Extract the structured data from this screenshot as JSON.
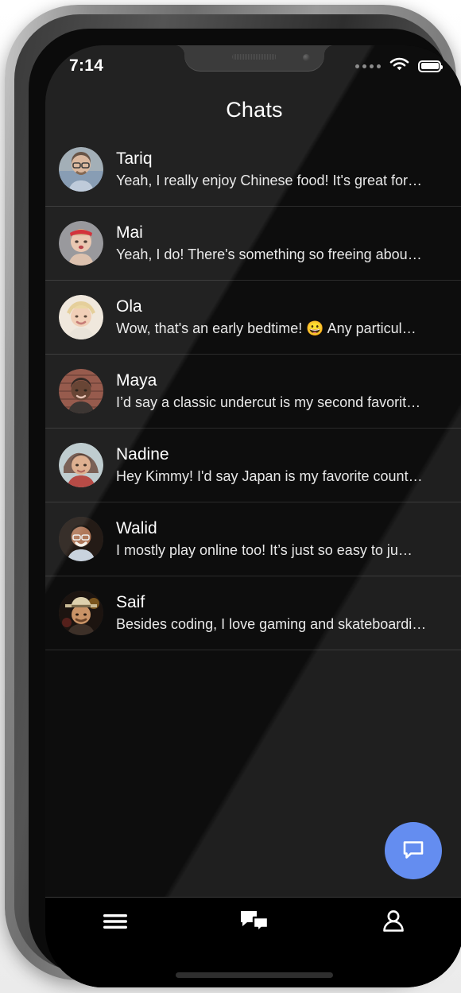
{
  "status_bar": {
    "time": "7:14",
    "signal_icon": "signal-dots-icon",
    "wifi_icon": "wifi-icon",
    "battery_icon": "battery-icon"
  },
  "header": {
    "title": "Chats"
  },
  "chats": [
    {
      "name": "Tariq",
      "message": "Yeah, I really enjoy Chinese food! It's great for…",
      "avatar": "avatar-tariq"
    },
    {
      "name": "Mai",
      "message": "Yeah, I do! There's something so freeing abou…",
      "avatar": "avatar-mai"
    },
    {
      "name": "Ola",
      "message": "Wow, that's an early bedtime! 😀  Any particul…",
      "avatar": "avatar-ola"
    },
    {
      "name": "Maya",
      "message": "I’d say a classic undercut is my second favorit…",
      "avatar": "avatar-maya"
    },
    {
      "name": "Nadine",
      "message": "Hey Kimmy! I'd say Japan is my favorite count…",
      "avatar": "avatar-nadine"
    },
    {
      "name": "Walid",
      "message": "I mostly play online too! It’s just so easy to ju…",
      "avatar": "avatar-walid"
    },
    {
      "name": "Saif",
      "message": "Besides coding, I love gaming and skateboardi…",
      "avatar": "avatar-saif"
    }
  ],
  "fab": {
    "icon": "new-chat-bubble-icon",
    "color": "#5784ef"
  },
  "tabbar": {
    "items": [
      {
        "icon": "menu-hamburger-icon",
        "active": false
      },
      {
        "icon": "chats-bubbles-icon",
        "active": true
      },
      {
        "icon": "profile-person-icon",
        "active": false
      }
    ]
  },
  "colors": {
    "screen_background": "#0d0d0d",
    "row_separator": "#2b2b2b",
    "name_text": "#ffffff",
    "message_text": "#e8e8e8",
    "accent": "#5784ef"
  }
}
